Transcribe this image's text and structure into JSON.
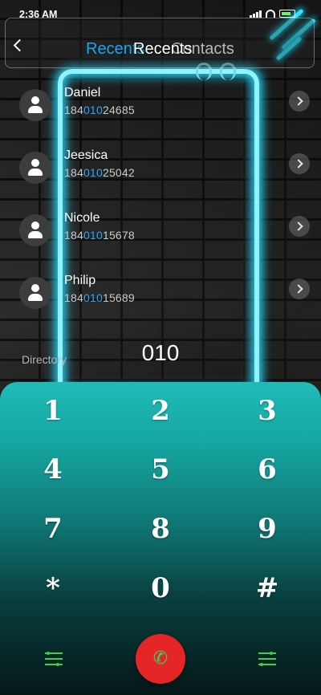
{
  "status_bar": {
    "time": "2:36 AM"
  },
  "header": {
    "back_icon": "chevron-left-icon",
    "tab_recents": "Recents",
    "tab_contacts": "Contacts",
    "title": "Recents"
  },
  "contacts": [
    {
      "name": "Daniel",
      "number_pre": "18",
      "number_a": "4",
      "number_hl": "010",
      "number_post": "24685"
    },
    {
      "name": "Jeesica",
      "number_pre": "18",
      "number_a": "4",
      "number_hl": "010",
      "number_post": "25042"
    },
    {
      "name": "Nicole",
      "number_pre": "18",
      "number_a": "4",
      "number_hl": "010",
      "number_post": "15678"
    },
    {
      "name": "Philip",
      "number_pre": "18",
      "number_a": "4",
      "number_hl": "010",
      "number_post": "15689"
    }
  ],
  "input": {
    "directory_label": "Directory",
    "dialed": "010"
  },
  "keypad": {
    "keys": [
      "1",
      "2",
      "3",
      "4",
      "5",
      "6",
      "7",
      "8",
      "9",
      "*",
      "0",
      "#"
    ]
  },
  "bottom_bar": {
    "left_icon": "menu-icon",
    "call_icon": "phone-icon",
    "right_icon": "menu-icon",
    "call_button_color": "#e52626"
  },
  "colors": {
    "accent": "#2aa6f0",
    "neon": "#31e3f5",
    "call": "#e52626",
    "icon_green": "#3fcf4c"
  }
}
